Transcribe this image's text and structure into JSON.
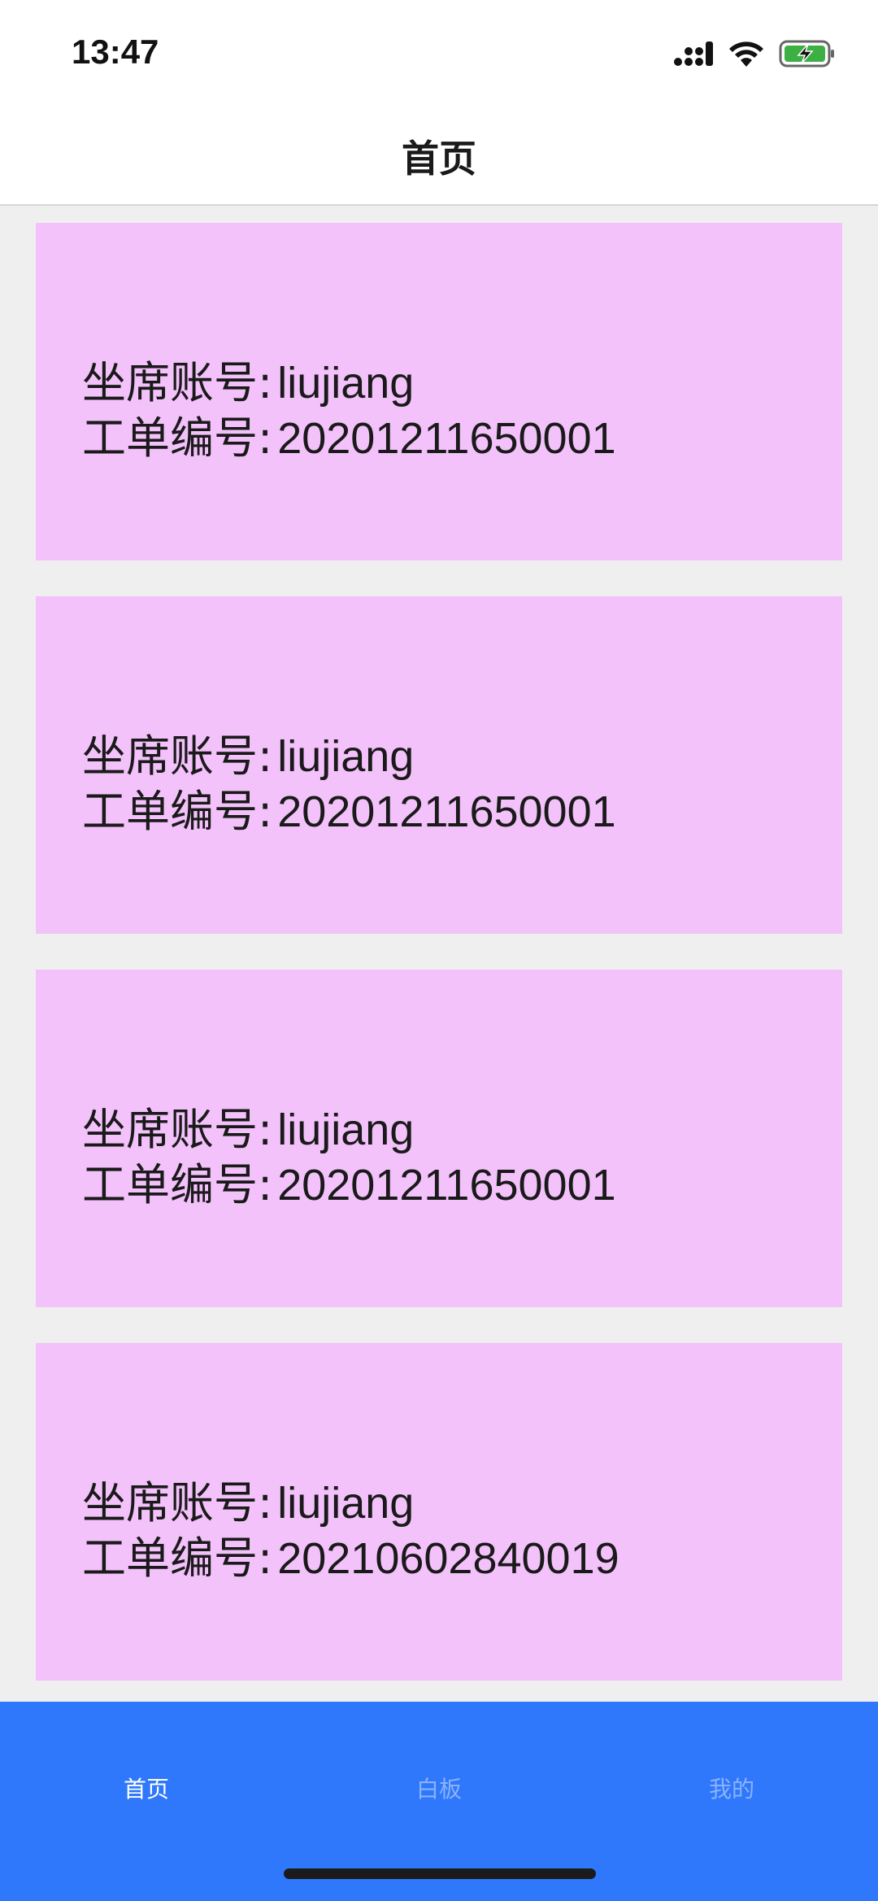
{
  "status_bar": {
    "time": "13:47"
  },
  "nav": {
    "title": "首页"
  },
  "cards": [
    {
      "account_label": "坐席账号:",
      "account_value": "liujiang",
      "order_label": "工单编号:",
      "order_value": "20201211650001"
    },
    {
      "account_label": "坐席账号:",
      "account_value": "liujiang",
      "order_label": "工单编号:",
      "order_value": "20201211650001"
    },
    {
      "account_label": "坐席账号:",
      "account_value": "liujiang",
      "order_label": "工单编号:",
      "order_value": "20201211650001"
    },
    {
      "account_label": "坐席账号:",
      "account_value": "liujiang",
      "order_label": "工单编号:",
      "order_value": "20210602840019"
    }
  ],
  "tab_bar": {
    "tabs": [
      {
        "label": "首页",
        "active": true
      },
      {
        "label": "白板",
        "active": false
      },
      {
        "label": "我的",
        "active": false
      }
    ]
  },
  "colors": {
    "card_bg": "#f4c2fb",
    "tab_bar_bg": "#2f78fb",
    "page_bg": "#f0eff0"
  }
}
